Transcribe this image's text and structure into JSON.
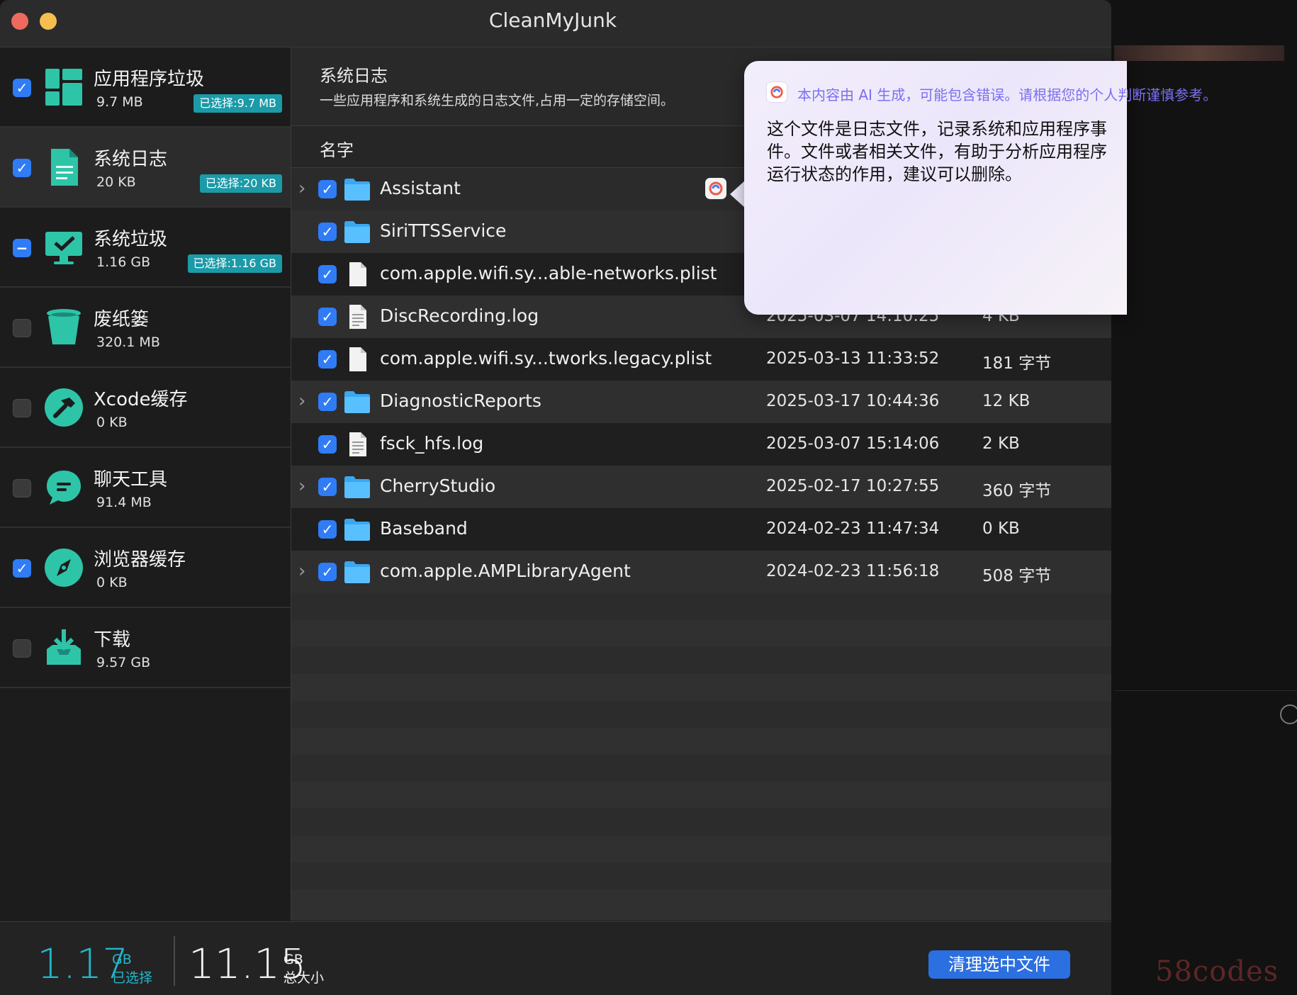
{
  "window": {
    "title": "CleanMyJunk"
  },
  "sidebar": {
    "items": [
      {
        "name": "应用程序垃圾",
        "size": "9.7 MB",
        "badge": "已选择:9.7 MB",
        "state": "checked",
        "icon": "app-grid-icon"
      },
      {
        "name": "系统日志",
        "size": "20 KB",
        "badge": "已选择:20 KB",
        "state": "checked",
        "icon": "document-icon"
      },
      {
        "name": "系统垃圾",
        "size": "1.16 GB",
        "badge": "已选择:1.16 GB",
        "state": "mixed",
        "icon": "monitor-check-icon"
      },
      {
        "name": "废纸篓",
        "size": "320.1 MB",
        "badge": "",
        "state": "unchecked",
        "icon": "trash-icon"
      },
      {
        "name": "Xcode缓存",
        "size": "0 KB",
        "badge": "",
        "state": "unchecked",
        "icon": "hammer-icon"
      },
      {
        "name": "聊天工具",
        "size": "91.4 MB",
        "badge": "",
        "state": "unchecked",
        "icon": "chat-bubble-icon"
      },
      {
        "name": "浏览器缓存",
        "size": "0 KB",
        "badge": "",
        "state": "checked",
        "icon": "compass-icon"
      },
      {
        "name": "下载",
        "size": "9.57 GB",
        "badge": "",
        "state": "unchecked",
        "icon": "download-tray-icon"
      }
    ]
  },
  "main": {
    "title": "系统日志",
    "description": "一些应用程序和系统生成的日志文件,占用一定的存储空间。",
    "column_name": "名字",
    "rows": [
      {
        "name": "Assistant",
        "date": "",
        "size": "",
        "type": "folder",
        "expandable": true
      },
      {
        "name": "SiriTTSService",
        "date": "",
        "size": "",
        "type": "folder",
        "expandable": false
      },
      {
        "name": "com.apple.wifi.sy...able-networks.plist",
        "date": "",
        "size": "",
        "type": "file",
        "expandable": false
      },
      {
        "name": "DiscRecording.log",
        "date": "2025-03-07 14:10:25",
        "size": "4 KB",
        "type": "log",
        "expandable": false
      },
      {
        "name": "com.apple.wifi.sy...tworks.legacy.plist",
        "date": "2025-03-13 11:33:52",
        "size": "181 字节",
        "type": "file",
        "expandable": false
      },
      {
        "name": "DiagnosticReports",
        "date": "2025-03-17 10:44:36",
        "size": "12 KB",
        "type": "folder",
        "expandable": true
      },
      {
        "name": "fsck_hfs.log",
        "date": "2025-03-07 15:14:06",
        "size": "2 KB",
        "type": "log",
        "expandable": false
      },
      {
        "name": "CherryStudio",
        "date": "2025-02-17 10:27:55",
        "size": "360 字节",
        "type": "folder",
        "expandable": true
      },
      {
        "name": "Baseband",
        "date": "2024-02-23 11:47:34",
        "size": "0 KB",
        "type": "folder",
        "expandable": false
      },
      {
        "name": "com.apple.AMPLibraryAgent",
        "date": "2024-02-23 11:56:18",
        "size": "508 字节",
        "type": "folder",
        "expandable": true
      }
    ]
  },
  "footer": {
    "selected_value": "1.17",
    "selected_unit": "GB",
    "selected_label": "已选择",
    "total_value": "11.15",
    "total_unit": "GB",
    "total_label": "总大小",
    "clean_button": "清理选中文件"
  },
  "ai_popup": {
    "notice": "本内容由 AI 生成，可能包含错误。请根据您的个人判断谨慎参考。",
    "text": "这个文件是日志文件，记录系统和应用程序事件。文件或者相关文件，有助于分析应用程序运行状态的作用，建议可以删除。"
  },
  "watermark": "58codes",
  "colors": {
    "accent": "#2f7cf6",
    "teal": "#22b7c9",
    "badge": "#1b9aa8",
    "button": "#2b6fe0"
  }
}
